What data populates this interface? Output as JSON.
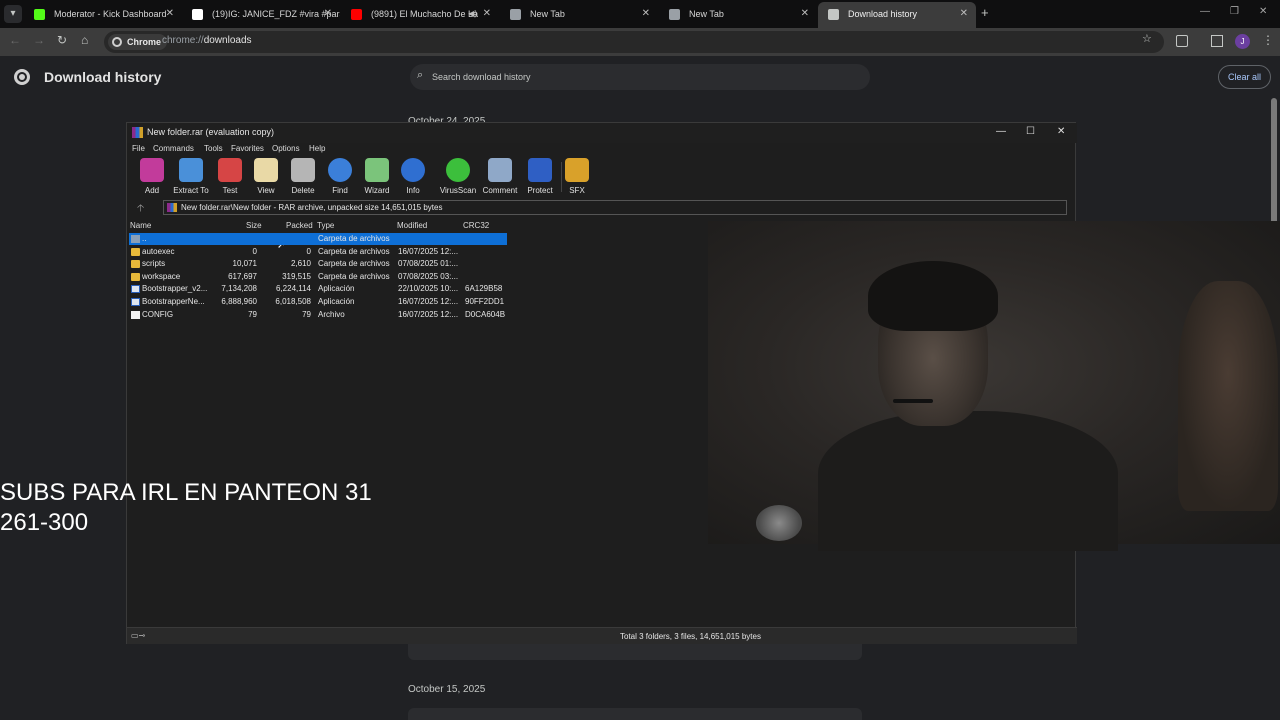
{
  "tabs": [
    {
      "title": "Moderator - Kick Dashboard",
      "color": "#53fc18"
    },
    {
      "title": "(19)IG: JANICE_FDZ #vira #para",
      "color": "#ffffff"
    },
    {
      "title": "(9891) El Muchacho De La",
      "color": "#ff0000"
    },
    {
      "title": "New Tab",
      "color": "#9aa0a6"
    },
    {
      "title": "New Tab",
      "color": "#9aa0a6"
    },
    {
      "title": "Download history",
      "color": "#c4c7c5"
    }
  ],
  "omnibox": {
    "chip": "Chrome",
    "scheme": "chrome://",
    "path": "downloads"
  },
  "downloads": {
    "title": "Download history",
    "search_placeholder": "Search download history",
    "clear_all": "Clear all",
    "date_top": "October 24, 2025",
    "date_bottom": "October 15, 2025"
  },
  "winrar": {
    "title": "New folder.rar (evaluation copy)",
    "menu": [
      "File",
      "Commands",
      "Tools",
      "Favorites",
      "Options",
      "Help"
    ],
    "tools": [
      {
        "label": "Add",
        "icon": "add-archive-icon",
        "color": "#c23b9b"
      },
      {
        "label": "Extract To",
        "icon": "extract-folder-icon",
        "color": "#4a90d9"
      },
      {
        "label": "Test",
        "icon": "test-clipboard-icon",
        "color": "#d64545"
      },
      {
        "label": "View",
        "icon": "view-book-icon",
        "color": "#e9d9a6"
      },
      {
        "label": "Delete",
        "icon": "delete-trash-icon",
        "color": "#b5b5b5"
      },
      {
        "label": "Find",
        "icon": "find-magnifier-icon",
        "color": "#3b7fd9"
      },
      {
        "label": "Wizard",
        "icon": "wizard-wand-icon",
        "color": "#7bc47b"
      },
      {
        "label": "Info",
        "icon": "info-icon",
        "color": "#2f6fd1"
      },
      {
        "label": "VirusScan",
        "icon": "virusscan-icon",
        "color": "#3cbf3c"
      },
      {
        "label": "Comment",
        "icon": "comment-icon",
        "color": "#8fa8c8"
      },
      {
        "label": "Protect",
        "icon": "protect-shield-icon",
        "color": "#2f5fc4"
      },
      {
        "label": "SFX",
        "icon": "sfx-icon",
        "color": "#d9a12a"
      }
    ],
    "path": "New folder.rar\\New folder - RAR archive, unpacked size 14,651,015 bytes",
    "columns": [
      "Name",
      "Size",
      "Packed",
      "Type",
      "Modified",
      "CRC32"
    ],
    "rows": [
      {
        "name": "..",
        "size": "",
        "packed": "",
        "type": "Carpeta de archivos",
        "modified": "",
        "crc": "",
        "kind": "up"
      },
      {
        "name": "autoexec",
        "size": "0",
        "packed": "0",
        "type": "Carpeta de archivos",
        "modified": "16/07/2025 12:...",
        "crc": "",
        "kind": "folder"
      },
      {
        "name": "scripts",
        "size": "10,071",
        "packed": "2,610",
        "type": "Carpeta de archivos",
        "modified": "07/08/2025 01:...",
        "crc": "",
        "kind": "folder"
      },
      {
        "name": "workspace",
        "size": "617,697",
        "packed": "319,515",
        "type": "Carpeta de archivos",
        "modified": "07/08/2025 03:...",
        "crc": "",
        "kind": "folder"
      },
      {
        "name": "Bootstrapper_v2...",
        "size": "7,134,208",
        "packed": "6,224,114",
        "type": "Aplicación",
        "modified": "22/10/2025 10:...",
        "crc": "6A129B58",
        "kind": "app"
      },
      {
        "name": "BootstrapperNe...",
        "size": "6,888,960",
        "packed": "6,018,508",
        "type": "Aplicación",
        "modified": "16/07/2025 12:...",
        "crc": "90FF2DD1",
        "kind": "app"
      },
      {
        "name": "CONFIG",
        "size": "79",
        "packed": "79",
        "type": "Archivo",
        "modified": "16/07/2025 12:...",
        "crc": "D0CA604B",
        "kind": "file"
      }
    ],
    "status": "Total 3 folders, 3 files, 14,651,015 bytes"
  },
  "overlay": {
    "line1": "SUBS PARA IRL EN PANTEON 31",
    "line2": "261-300"
  }
}
